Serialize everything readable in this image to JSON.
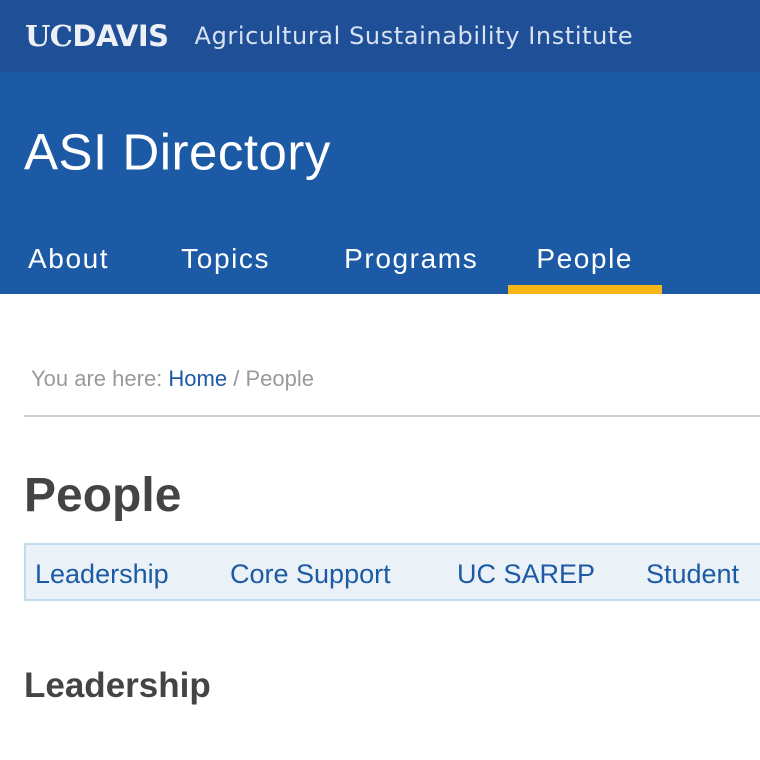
{
  "topbar": {
    "logo_uc": "UC",
    "logo_davis": "DAVIS",
    "institute_name": "Agricultural Sustainability Institute"
  },
  "header": {
    "site_title": "ASI Directory"
  },
  "nav": {
    "items": [
      {
        "label": "About"
      },
      {
        "label": "Topics"
      },
      {
        "label": "Programs"
      },
      {
        "label": "People",
        "active": true
      }
    ]
  },
  "breadcrumb": {
    "prefix": "You are here:",
    "home": "Home",
    "separator": "/",
    "current": "People"
  },
  "page": {
    "title": "People",
    "subnav": [
      {
        "label": "Leadership"
      },
      {
        "label": "Core Support"
      },
      {
        "label": "UC SAREP"
      },
      {
        "label": "Student"
      }
    ],
    "section_title": "Leadership"
  },
  "colors": {
    "topbar_bg": "#1f4f97",
    "header_bg": "#1c5aa6",
    "active_underline": "#f5b617",
    "link": "#1c5aa6",
    "subnav_bg": "#eaf2f8",
    "subnav_border": "#bfdcef"
  }
}
